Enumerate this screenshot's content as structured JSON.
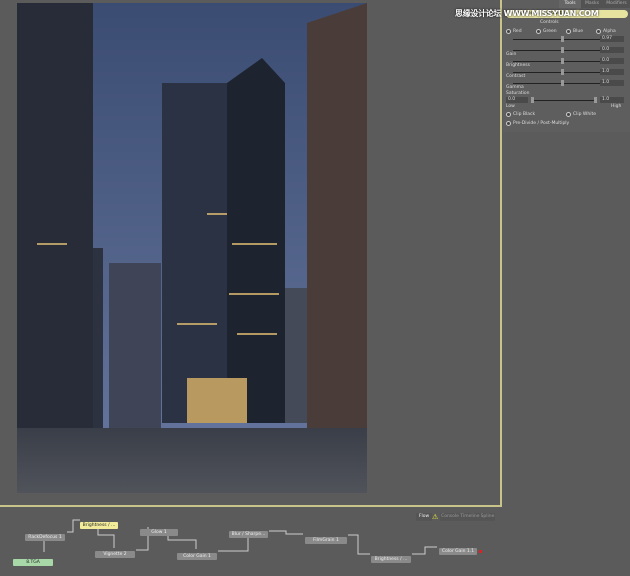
{
  "watermark": "思缘设计论坛 WWW.MISSYUAN.COM",
  "panel": {
    "tabs": [
      "Tools",
      "Masks",
      "Modifiers"
    ],
    "tool_title": "Brightness / Contrast 1",
    "section": "Controls",
    "channels": [
      "Red",
      "Green",
      "Blue",
      "Alpha"
    ],
    "sliders": [
      {
        "label": "",
        "value": "0.97",
        "fraction": 0.55
      },
      {
        "label": "Gain",
        "value": "0.0",
        "fraction": 0.55
      },
      {
        "label": "Brightness",
        "value": "0.0",
        "fraction": 0.55
      },
      {
        "label": "Contrast",
        "value": "1.0",
        "fraction": 0.55
      },
      {
        "label": "Gamma",
        "value": "1.0",
        "fraction": 0.55
      }
    ],
    "saturation": {
      "label": "Saturation",
      "low_value": "0.0",
      "high_value": "1.0",
      "low": "Low",
      "high": "High"
    },
    "options": [
      "Clip Black",
      "Clip White",
      "Pre-Divide / Post-Multiply"
    ]
  },
  "flow_tabs": [
    "Flow",
    "Console",
    "Timeline",
    "Spline"
  ],
  "nodes": [
    "RackDefocus 1",
    "Brightness / ...",
    "8.TGA",
    "Vignette 2",
    "Glow 1",
    "Color Gain 1",
    "Blur / Sharpe...",
    "FilmGrain 1",
    "Brightness / ...",
    "Color Gain 1.1"
  ],
  "colors": {
    "accent": "#c9c48a",
    "selected_node": "#f2ec9a",
    "loader_node": "#a8d8a8"
  }
}
